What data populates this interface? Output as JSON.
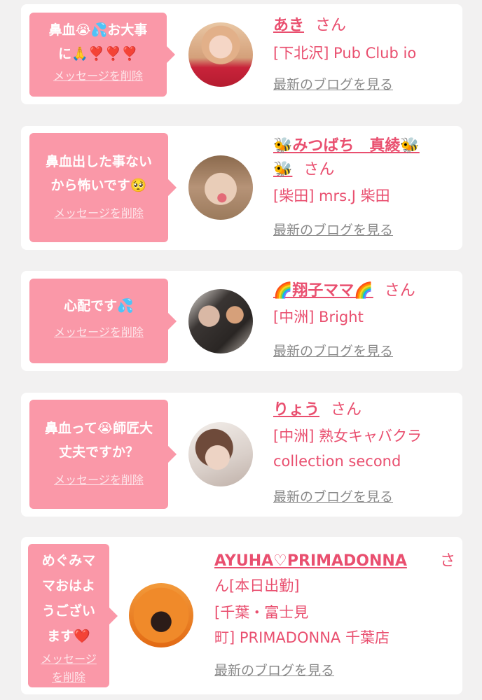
{
  "colors": {
    "bubble": "#fa98a8",
    "accent_pink": "#e94f6f",
    "link_gray": "#8a8a8a",
    "page_bg": "#f2f1f1"
  },
  "messages": [
    {
      "bubble_lines": [
        "鼻血😭💦お大事",
        "に🙏❣️❣️❣️"
      ],
      "delete_label": "メッセージを削除",
      "name": "あき",
      "honorific": "さん",
      "shop_lines": [
        "[下北沢] Pub Club io"
      ],
      "blog_label": "最新のブログを見る"
    },
    {
      "bubble_lines": [
        "鼻血出した事ない",
        "から怖いです🥺"
      ],
      "delete_label": "メッセージを削除",
      "name_line1": "🐝みつばち　真綾🐝",
      "name_line2": "🐝",
      "honorific": "さん",
      "shop_lines": [
        "[柴田] mrs.J 柴田"
      ],
      "blog_label": "最新のブログを見る"
    },
    {
      "bubble_lines": [
        "心配です💦"
      ],
      "delete_label": "メッセージを削除",
      "name": "🌈翔子ママ🌈",
      "honorific": "さん",
      "shop_lines": [
        "[中洲] Bright"
      ],
      "blog_label": "最新のブログを見る"
    },
    {
      "bubble_lines": [
        "鼻血って😭師匠大",
        "丈夫ですか？"
      ],
      "delete_label": "メッセージを削除",
      "name": "りょう",
      "honorific": "さん",
      "shop_lines": [
        "[中洲] 熟女キャバクラ",
        "collection second"
      ],
      "blog_label": "最新のブログを見る"
    },
    {
      "bubble_lines": [
        "めぐみマ",
        "マおはよ",
        "うござい",
        "ます❤️"
      ],
      "delete_lines": [
        "メッセージ",
        "を削除"
      ],
      "name": "AYUHA♡PRIMADONNA",
      "honorific_part1": "さ",
      "honorific_part2": "ん",
      "status": "[本日出勤]",
      "shop_lines": [
        "[千葉・富士見",
        "町] PRIMADONNA 千葉店"
      ],
      "blog_label": "最新のブログを見る"
    }
  ]
}
